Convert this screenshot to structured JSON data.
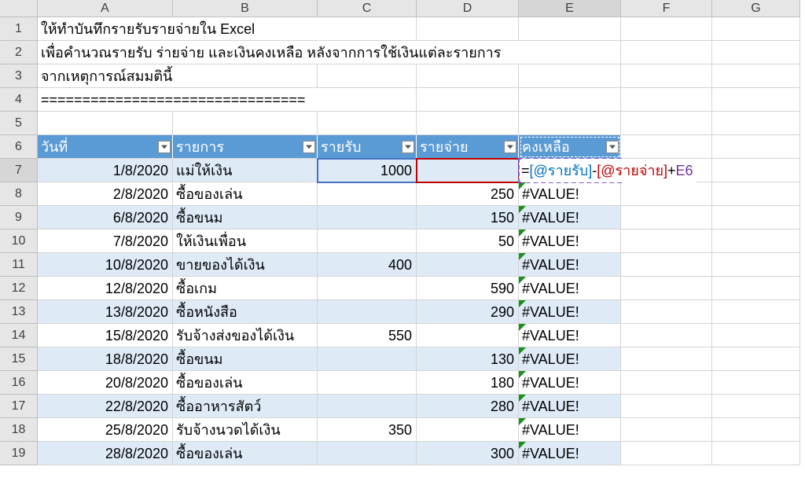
{
  "columns": [
    "",
    "A",
    "B",
    "C",
    "D",
    "E",
    "F",
    "G"
  ],
  "rowNumbers": [
    "1",
    "2",
    "3",
    "4",
    "5",
    "6",
    "7",
    "8",
    "9",
    "10",
    "11",
    "12",
    "13",
    "14",
    "15",
    "16",
    "17",
    "18",
    "19"
  ],
  "intro": {
    "r1": "ให้ทำบันทึกรายรับรายจ่ายใน Excel",
    "r2": "เพื่อคำนวณรายรับ ร่ายจ่าย และเงินคงเหลือ หลังจากการใช้เงินแต่ละรายการ",
    "r3": "จากเหตุการณ์สมมตินี้",
    "r4": "================================"
  },
  "headers": {
    "A": "วันที่",
    "B": "รายการ",
    "C": "รายรับ",
    "D": "รายจ่าย",
    "E": "คงเหลือ"
  },
  "table": [
    {
      "date": "1/8/2020",
      "item": "แม่ให้เงิน",
      "in": "1000",
      "out": "",
      "bal": ""
    },
    {
      "date": "2/8/2020",
      "item": "ซื้อของเล่น",
      "in": "",
      "out": "250",
      "bal": "#VALUE!"
    },
    {
      "date": "6/8/2020",
      "item": "ซื้อขนม",
      "in": "",
      "out": "150",
      "bal": "#VALUE!"
    },
    {
      "date": "7/8/2020",
      "item": "ให้เงินเพื่อน",
      "in": "",
      "out": "50",
      "bal": "#VALUE!"
    },
    {
      "date": "10/8/2020",
      "item": "ขายของได้เงิน",
      "in": "400",
      "out": "",
      "bal": "#VALUE!"
    },
    {
      "date": "12/8/2020",
      "item": "ซื้อเกม",
      "in": "",
      "out": "590",
      "bal": "#VALUE!"
    },
    {
      "date": "13/8/2020",
      "item": "ซื้อหนังสือ",
      "in": "",
      "out": "290",
      "bal": "#VALUE!"
    },
    {
      "date": "15/8/2020",
      "item": "รับจ้างส่งของได้เงิน",
      "in": "550",
      "out": "",
      "bal": "#VALUE!"
    },
    {
      "date": "18/8/2020",
      "item": "ซื้อขนม",
      "in": "",
      "out": "130",
      "bal": "#VALUE!"
    },
    {
      "date": "20/8/2020",
      "item": "ซื้อของเล่น",
      "in": "",
      "out": "180",
      "bal": "#VALUE!"
    },
    {
      "date": "22/8/2020",
      "item": "ซื้ออาหารสัตว์",
      "in": "",
      "out": "280",
      "bal": "#VALUE!"
    },
    {
      "date": "25/8/2020",
      "item": "รับจ้างนวดได้เงิน",
      "in": "350",
      "out": "",
      "bal": "#VALUE!"
    },
    {
      "date": "28/8/2020",
      "item": "ซื้อของเล่น",
      "in": "",
      "out": "300",
      "bal": "#VALUE!"
    }
  ],
  "formula": {
    "eq": "=",
    "ref1": "[@รายรับ]",
    "minus": "-",
    "ref2": "[@รายจ่าย]",
    "plus": "+",
    "ref3": "E6"
  },
  "activeRow": "7",
  "activeCol": "E"
}
